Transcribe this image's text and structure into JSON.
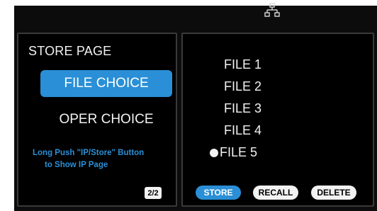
{
  "colors": {
    "accent": "#2a8fd6",
    "background": "#000000",
    "text": "#f2f2f2",
    "border": "#3a3a3a"
  },
  "topbar": {
    "status_icon": "network-icon"
  },
  "left_panel": {
    "title": "STORE PAGE",
    "choices": [
      {
        "label": "FILE CHOICE",
        "selected": true
      },
      {
        "label": "OPER CHOICE",
        "selected": false
      }
    ],
    "hint_line1": "Long Push \"IP/Store\" Button",
    "hint_line2": "to Show IP Page",
    "page_indicator": "2/2"
  },
  "right_panel": {
    "files": [
      {
        "label": "FILE 1",
        "selected": false
      },
      {
        "label": "FILE 2",
        "selected": false
      },
      {
        "label": "FILE 3",
        "selected": false
      },
      {
        "label": "FILE 4",
        "selected": false
      },
      {
        "label": "FILE 5",
        "selected": true
      }
    ],
    "buttons": {
      "store": "STORE",
      "recall": "RECALL",
      "delete": "DELETE"
    }
  }
}
